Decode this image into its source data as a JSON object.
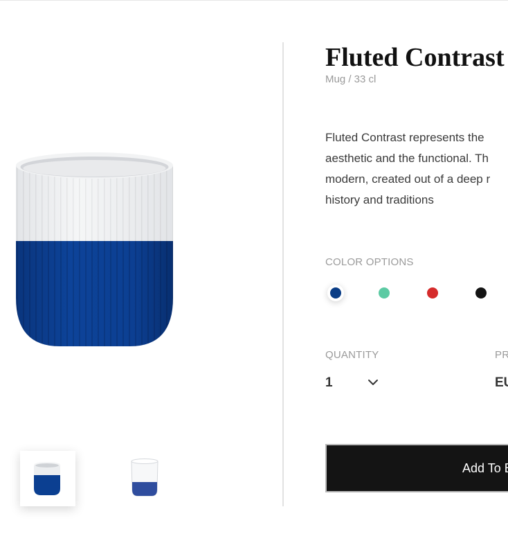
{
  "product": {
    "title": "Fluted Contrast",
    "subtitle": "Mug / 33 cl",
    "description_lines": [
      "Fluted Contrast represents the",
      "aesthetic and the functional. Th",
      "modern, created out of a deep r",
      "history and traditions"
    ]
  },
  "gallery": {
    "main_image": "mug-blue-white-image",
    "thumbnails": [
      {
        "name": "thumbnail-blue-mug",
        "active": true
      },
      {
        "name": "thumbnail-glass-mug",
        "active": false
      }
    ]
  },
  "color_options": {
    "label": "COLOR OPTIONS",
    "selected": "#0a3d86",
    "swatches": [
      "#0a3d86",
      "#5ccaa3",
      "#d52b2b",
      "#141414"
    ]
  },
  "quantity": {
    "label": "QUANTITY",
    "value": "1",
    "icon": "chevron-down-icon"
  },
  "price": {
    "label": "PR",
    "value": "EU"
  },
  "cart": {
    "button_label": "Add To B"
  },
  "colors": {
    "mug_blue": "#0b3f91",
    "mug_white": "#f1f2f3",
    "button": "#141414"
  }
}
